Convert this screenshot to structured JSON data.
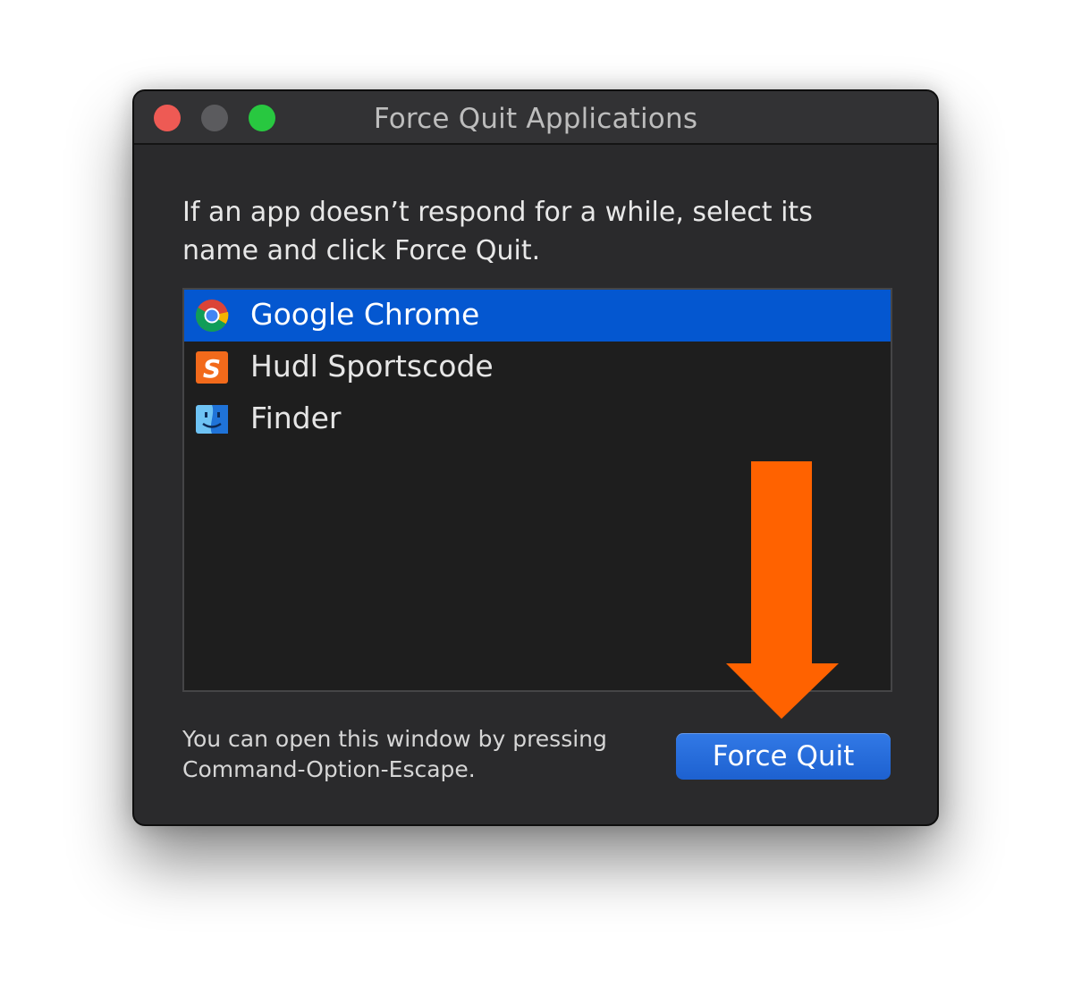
{
  "window": {
    "title": "Force Quit Applications"
  },
  "instructions": "If an app doesn’t respond for a while, select its name and click Force Quit.",
  "apps": [
    {
      "name": "Google Chrome",
      "icon": "chrome-icon",
      "selected": true
    },
    {
      "name": "Hudl Sportscode",
      "icon": "sportscode-icon",
      "selected": false
    },
    {
      "name": "Finder",
      "icon": "finder-icon",
      "selected": false
    }
  ],
  "footer": {
    "note": "You can open this window by pressing Command-Option-Escape.",
    "force_quit_label": "Force Quit"
  },
  "colors": {
    "selection": "#0457d0",
    "button": "#1d61d0",
    "annotation_arrow": "#ff6200"
  }
}
